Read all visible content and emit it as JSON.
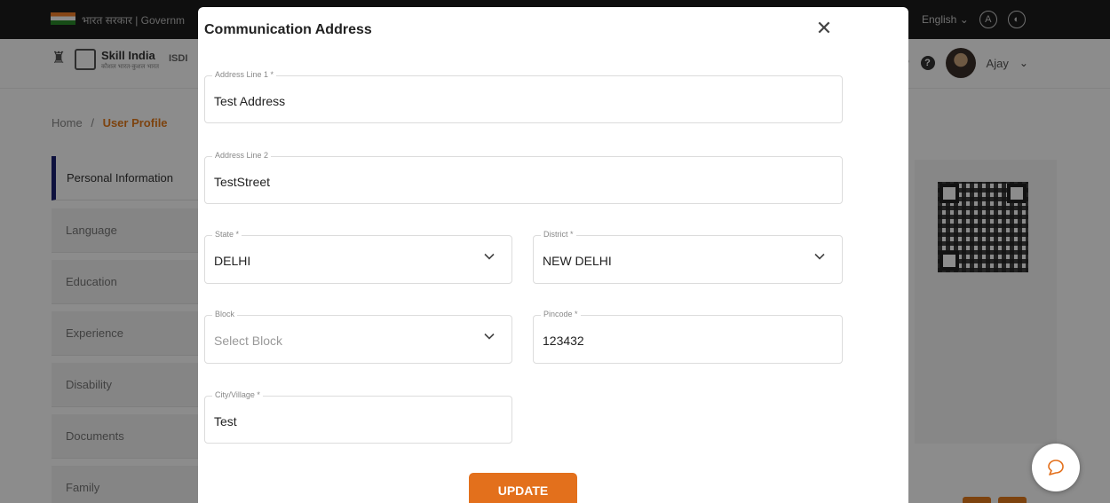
{
  "gov_bar": {
    "text": "भारत सरकार | Governm",
    "language": "English",
    "accessibility_label": "A"
  },
  "header": {
    "brand": "Skill India",
    "brand_tagline": "कौशल भारत-कुशल भारत",
    "extra": "ISDI",
    "user_name": "Ajay"
  },
  "breadcrumb": {
    "home": "Home",
    "separator": "/",
    "current": "User Profile"
  },
  "sidebar": {
    "items": [
      {
        "label": "Personal Information"
      },
      {
        "label": "Language"
      },
      {
        "label": "Education"
      },
      {
        "label": "Experience"
      },
      {
        "label": "Disability"
      },
      {
        "label": "Documents"
      },
      {
        "label": "Family"
      }
    ]
  },
  "modal": {
    "title": "Communication Address",
    "fields": {
      "address_line_1": {
        "label": "Address Line 1 *",
        "value": "Test Address"
      },
      "address_line_2": {
        "label": "Address Line 2",
        "value": "TestStreet"
      },
      "state": {
        "label": "State *",
        "value": "DELHI"
      },
      "district": {
        "label": "District *",
        "value": "NEW DELHI"
      },
      "block": {
        "label": "Block",
        "placeholder": "Select Block"
      },
      "pincode": {
        "label": "Pincode *",
        "value": "123432"
      },
      "city_village": {
        "label": "City/Village *",
        "value": "Test"
      }
    },
    "update_label": "UPDATE"
  },
  "colors": {
    "accent": "#e3701c",
    "active_border": "#1a1f71"
  },
  "icons": {
    "close": "close-icon",
    "dropdown": "chevron-down-icon",
    "chat": "chat-icon"
  }
}
